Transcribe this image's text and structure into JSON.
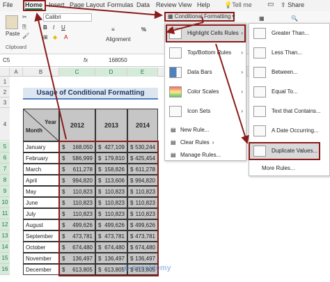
{
  "menu": [
    "File",
    "Home",
    "Insert",
    "Page Layout",
    "Formulas",
    "Data",
    "Review",
    "View",
    "Help",
    "Tell me",
    "Share"
  ],
  "ribbon": {
    "paste": "Paste",
    "clipboard": "Clipboard",
    "font_name": "Calibri",
    "alignment": "Alignment",
    "number": "Number",
    "cells": "Cells",
    "editing": "Editing",
    "cond_format": "Conditional Formatting"
  },
  "formula": {
    "name_box": "C5",
    "fx": "fx",
    "value": "168050"
  },
  "columns": [
    "A",
    "B",
    "C",
    "D",
    "E",
    "F"
  ],
  "rows": [
    "1",
    "2",
    "3",
    "4",
    "5",
    "6",
    "7",
    "8",
    "9",
    "10",
    "11",
    "12",
    "13",
    "14",
    "15",
    "16"
  ],
  "sheet": {
    "title": "Usage of Conditional Formatting",
    "header_year": "Year",
    "header_month": "Month",
    "years": [
      "2012",
      "2013",
      "2014"
    ],
    "data": [
      [
        "January",
        "168,050",
        "427,109",
        "530,244"
      ],
      [
        "February",
        "586,999",
        "179,810",
        "425,454"
      ],
      [
        "March",
        "611,278",
        "158,826",
        "611,278"
      ],
      [
        "April",
        "994,820",
        "113,606",
        "994,820"
      ],
      [
        "May",
        "110,823",
        "110,823",
        "110,823"
      ],
      [
        "June",
        "110,823",
        "110,823",
        "110,823"
      ],
      [
        "July",
        "110,823",
        "110,823",
        "110,823"
      ],
      [
        "August",
        "499,626",
        "499,626",
        "499,626"
      ],
      [
        "September",
        "473,781",
        "473,781",
        "473,781"
      ],
      [
        "October",
        "674,480",
        "674,480",
        "674,480"
      ],
      [
        "November",
        "136,497",
        "136,497",
        "136,497"
      ],
      [
        "December",
        "613,805",
        "613,805",
        "613,805"
      ]
    ],
    "currency": "$"
  },
  "cf_menu": [
    {
      "label": "Highlight Cells Rules",
      "icon": "highlight-cells-icon",
      "arrow": "›"
    },
    {
      "label": "Top/Bottom Rules",
      "icon": "top-bottom-icon",
      "arrow": "›"
    },
    {
      "label": "Data Bars",
      "icon": "data-bars-icon",
      "arrow": "›"
    },
    {
      "label": "Color Scales",
      "icon": "color-scales-icon",
      "arrow": "›"
    },
    {
      "label": "Icon Sets",
      "icon": "icon-sets-icon",
      "arrow": "›"
    }
  ],
  "cf_extra": [
    "New Rule...",
    "Clear Rules",
    "Manage Rules..."
  ],
  "hc_menu": [
    "Greater Than...",
    "Less Than...",
    "Between...",
    "Equal To...",
    "Text that Contains...",
    "A Date Occurring...",
    "Duplicate Values..."
  ],
  "more_rules": "More Rules...",
  "watermark": "exceldemy"
}
